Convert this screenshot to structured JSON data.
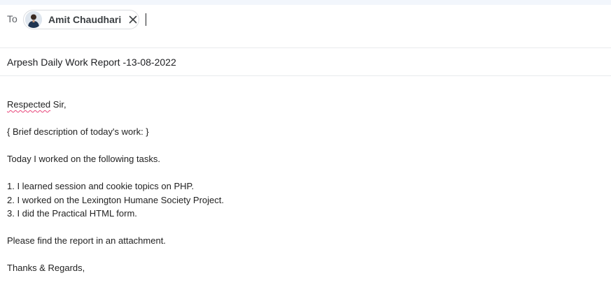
{
  "compose": {
    "to_label": "To",
    "recipient": {
      "name": "Amit Chaudhari",
      "remove_icon": "close-icon"
    },
    "subject": "Arpesh Daily Work Report -13-08-2022",
    "body": {
      "greeting_word": "Respected",
      "greeting_rest": " Sir,",
      "lines": [
        "",
        "{ Brief description of today's work: }",
        "",
        "Today I worked on the following tasks.",
        "",
        "1. I learned session and cookie topics on PHP.",
        "2. I worked on the Lexington Humane Society Project.",
        "3. I did the Practical HTML form.",
        "",
        "Please find the report in an attachment.",
        "",
        "Thanks & Regards,"
      ]
    }
  },
  "colors": {
    "spellcheck_underline": "#e8457a",
    "divider": "#e8eaed",
    "topbar": "#f2f6fc"
  }
}
